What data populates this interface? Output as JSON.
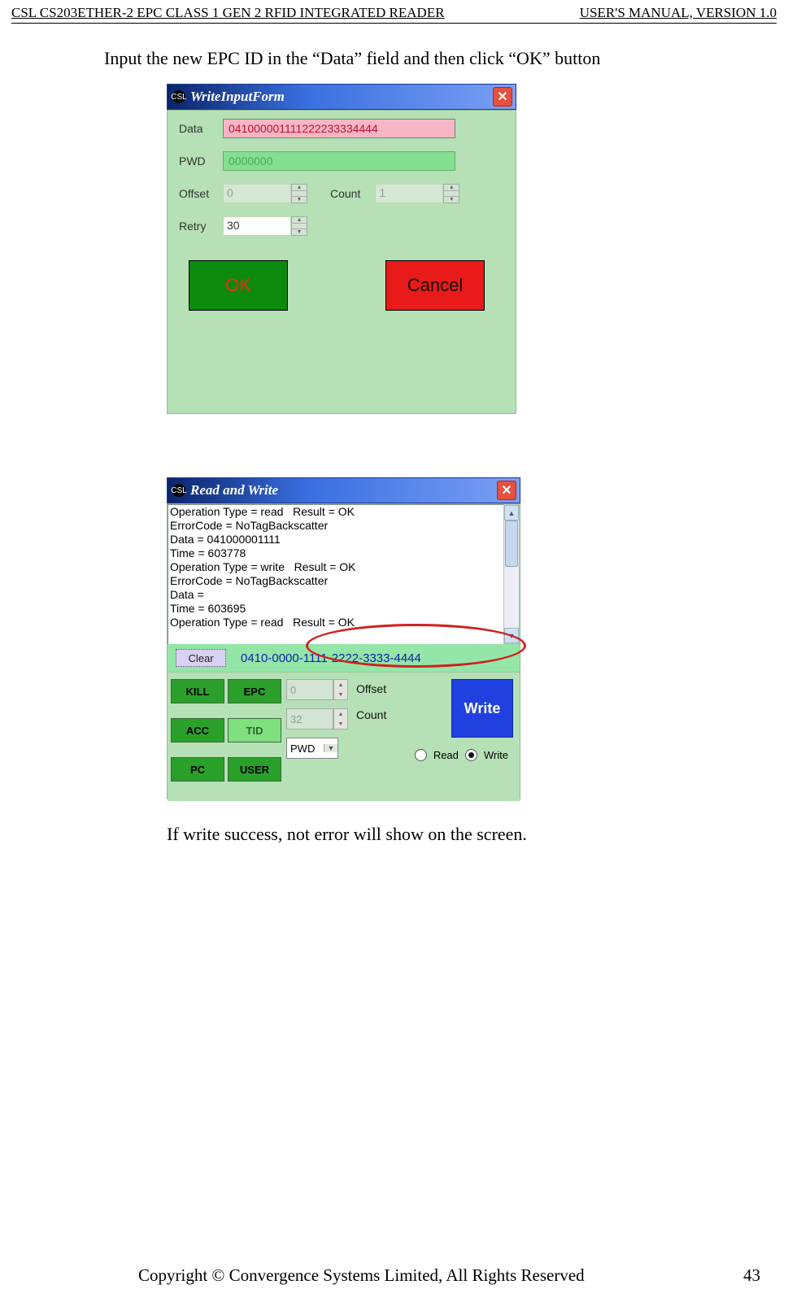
{
  "header": {
    "left": "CSL CS203ETHER-2 EPC CLASS 1 GEN 2 RFID INTEGRATED READER",
    "right": "USER'S  MANUAL,  VERSION  1.0"
  },
  "caption1": "Input the new EPC ID in the “Data” field and then click “OK” button",
  "caption2": "If write success, not error will show on the screen.",
  "footer": {
    "left": "Copyright © Convergence Systems Limited, All Rights Reserved",
    "right": "43"
  },
  "win1": {
    "title": "WriteInputForm",
    "labels": {
      "data": "Data",
      "pwd": "PWD",
      "offset": "Offset",
      "count": "Count",
      "retry": "Retry"
    },
    "values": {
      "data": "041000001111222233334444",
      "pwd": "0000000",
      "offset": "0",
      "count": "1",
      "retry": "30"
    },
    "buttons": {
      "ok": "OK",
      "cancel": "Cancel"
    }
  },
  "win2": {
    "title": "Read and Write",
    "log": "Operation Type = read   Result = OK\nErrorCode = NoTagBackscatter\nData = 041000001111\nTime = 603778\nOperation Type = write   Result = OK\nErrorCode = NoTagBackscatter\nData =\nTime = 603695\nOperation Type = read   Result = OK",
    "clear": "Clear",
    "epc": "0410-0000-1111-2222-3333-4444",
    "btns": {
      "kill": "KILL",
      "epc": "EPC",
      "acc": "ACC",
      "tid": "TID",
      "pc": "PC",
      "user": "USER"
    },
    "fields": {
      "offset": "0",
      "count": "32",
      "select": "PWD"
    },
    "flabels": {
      "offset": "Offset",
      "count": "Count"
    },
    "write": "Write",
    "radios": {
      "read": "Read",
      "write": "Write"
    }
  }
}
